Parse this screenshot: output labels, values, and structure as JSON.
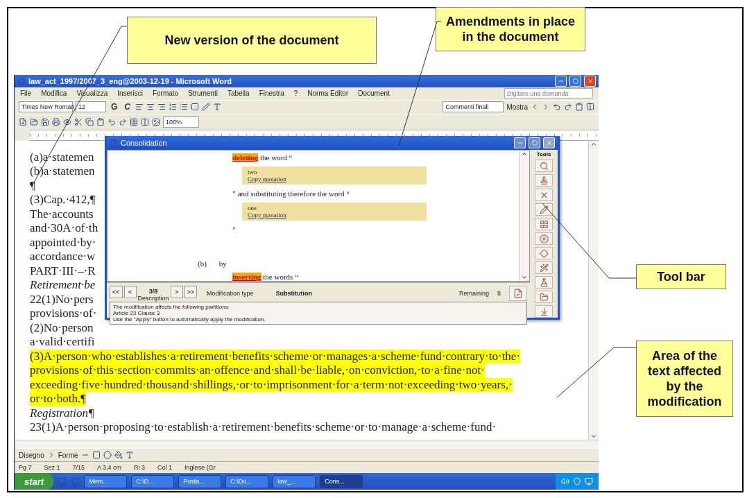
{
  "top_callouts": [
    {
      "text": "New version of the document"
    },
    {
      "text": "Amendments in place in the document"
    }
  ],
  "side_callouts": [
    {
      "text": "Tool bar"
    },
    {
      "text": "Area of the text affected by the modification"
    }
  ],
  "word": {
    "title": "law_act_1997/2007_3_eng@2003-12-19 - Microsoft Word",
    "menu": [
      "File",
      "Modifica",
      "Visualizza",
      "Inserisci",
      "Formato",
      "Strumenti",
      "Tabella",
      "Finestra",
      "?",
      "Norma Editor",
      "Document"
    ],
    "search_placeholder": "Digitare una domanda",
    "font": "Times New Roman",
    "size": "12",
    "bold": "G",
    "italic": "C",
    "markup_view": "Commenti finali",
    "show": "Mostra",
    "zoom": "100%",
    "lines": [
      {
        "kind": "plain",
        "text": "(a)a·statemen"
      },
      {
        "kind": "plain",
        "text": "(b)a·statemen"
      },
      {
        "kind": "plain",
        "text": "¶"
      },
      {
        "kind": "plain",
        "text": "(3)Cap.·412,¶"
      },
      {
        "kind": "plain",
        "text": "The·accounts"
      },
      {
        "kind": "plain",
        "text": "and·30A·of·th"
      },
      {
        "kind": "plain",
        "text": "appointed·by·"
      },
      {
        "kind": "plain",
        "text": "accordance·w"
      },
      {
        "kind": "plain",
        "text": "PART·III·–·R"
      },
      {
        "kind": "italic",
        "text": "Retirement·be"
      },
      {
        "kind": "plain",
        "text": "22(1)No·pers"
      },
      {
        "kind": "plain",
        "text": "provisions·of·"
      },
      {
        "kind": "plain",
        "text": "(2)No·person"
      },
      {
        "kind": "plain",
        "text": "a·valid·certifi"
      },
      {
        "kind": "highlight",
        "text": "(3)A·person·who·establishes·a·retirement·benefits·scheme·or·manages·a·scheme·fund·contrary·to·the·"
      },
      {
        "kind": "highlight",
        "text": "provisions·of·this·section·commits·an·offence·and·shall·be·liable,·on·conviction,·to·a·fine·not·"
      },
      {
        "kind": "highlight",
        "text": "exceeding·five·hundred·thousand·shillings,·or·to·imprisonment·for·a·term·not·exceeding·two·years,·"
      },
      {
        "kind": "highlight",
        "text": "or·to·both.¶"
      },
      {
        "kind": "italic",
        "text": "Registration¶"
      },
      {
        "kind": "plain",
        "text": "23(1)A·person·proposing·to·establish·a·retirement·benefits·scheme·or·to·manage·a·scheme·fund·"
      }
    ],
    "drawing_menus": [
      "Disegno",
      "Forme"
    ],
    "status": [
      "Pg 7",
      "Sez 1",
      "7/15",
      "A 3,4 cm",
      "Ri 3",
      "Col 1",
      "Inglese (Gr"
    ],
    "start": "start",
    "tasks": [
      {
        "label": "Mem...",
        "selected": false
      },
      {
        "label": "C:\\D...",
        "selected": false
      },
      {
        "label": "Posta...",
        "selected": false
      },
      {
        "label": "C:\\Do...",
        "selected": false
      },
      {
        "label": "law_...",
        "selected": false
      },
      {
        "label": "Cons...",
        "selected": true
      }
    ]
  },
  "dialog": {
    "title": "Consolidation",
    "tools_label": "Tools",
    "content": [
      {
        "kind": "action",
        "mark": "deleting",
        "text": " the word “"
      },
      {
        "kind": "quote",
        "value": "two",
        "link": "Copy quotation"
      },
      {
        "kind": "text",
        "text": "” and substituting therefore the word “"
      },
      {
        "kind": "quote",
        "value": "one",
        "link": "Copy quotation"
      },
      {
        "kind": "text",
        "text": "”"
      },
      {
        "kind": "item",
        "num": "(b)",
        "text": "by"
      },
      {
        "kind": "action",
        "mark": "inserting",
        "text": " the words “"
      }
    ],
    "first": "<<",
    "prev": "<",
    "position": "3/8",
    "next": ">",
    "last": ">>",
    "description_label": "Description",
    "type_label": "Modification type",
    "type_value": "Substitution",
    "remaining_label": "Remaining",
    "remaining_value": "8",
    "info": [
      "The modification affects the following partitions:",
      "Article 22 Clause 3",
      "Use the \"Apply\" button to automatically apply the modification."
    ]
  }
}
